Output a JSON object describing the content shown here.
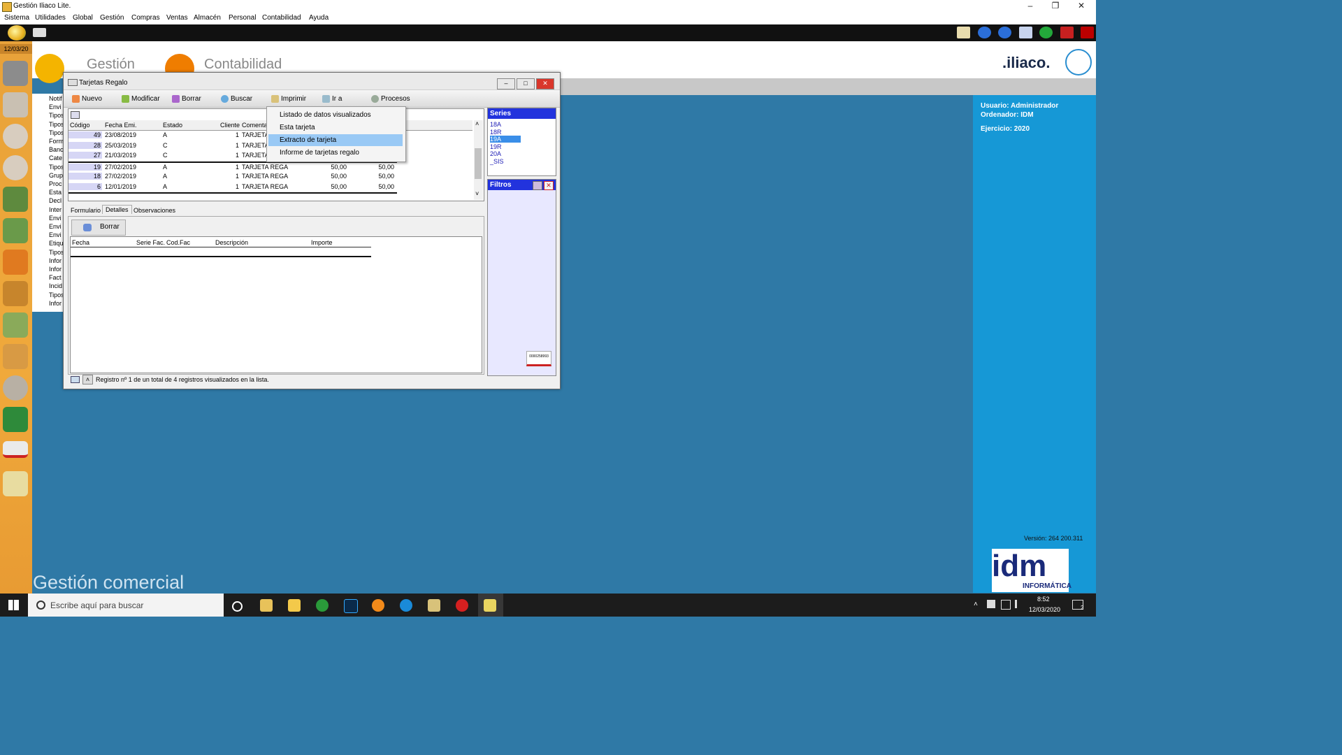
{
  "window_title": "Gestión Iliaco Lite.",
  "menu": [
    "Sistema",
    "Utilidades",
    "Global",
    "Gestión",
    "Compras",
    "Ventas",
    "Almacén",
    "Personal",
    "Contabilidad",
    "Ayuda"
  ],
  "date_badge": "12/03/20",
  "header": {
    "logo1": "Gestión",
    "logo2": "Contabilidad",
    "brand": ".iliaco."
  },
  "user_panel": {
    "usuario": "Usuario: Administrador",
    "ordenador": "Ordenador: IDM",
    "ejercicio": "Ejercicio: 2020",
    "version": "Versión: 264 200.311",
    "idm": "idm",
    "informatica": "INFORMÁTICA"
  },
  "footer_title": "Gestión comercial",
  "left_names": [
    "Notif",
    "Envi",
    "Tipos",
    "Tipos",
    "Tipos",
    "Form",
    "Banc",
    "Cate",
    "Tipos",
    "Grup",
    "Proc",
    "Esta",
    "Decl",
    "Inter",
    "Envi",
    "Envi",
    "Envi",
    "Etiqu",
    "Tipos",
    "Infor",
    "Infor",
    "Fact",
    "Incid",
    "Tipos",
    "Infor"
  ],
  "tarjetas": {
    "title": "Tarjetas Regalo",
    "toolbar": [
      "Nuevo",
      "Modificar",
      "Borrar",
      "Buscar",
      "Imprimir",
      "Ir a",
      "Procesos"
    ],
    "columns": [
      "Código",
      "Fecha Emi.",
      "Estado",
      "Cliente",
      "Comenta"
    ],
    "rows": [
      {
        "codigo": "49",
        "fecha": "23/08/2019",
        "estado": "A",
        "cliente": "1",
        "comentario": "TARJETA",
        "v1": "",
        "v2": ""
      },
      {
        "codigo": "28",
        "fecha": "25/03/2019",
        "estado": "C",
        "cliente": "1",
        "comentario": "TARJETA",
        "v1": "",
        "v2": ""
      },
      {
        "codigo": "27",
        "fecha": "21/03/2019",
        "estado": "C",
        "cliente": "1",
        "comentario": "TARJETA",
        "v1": "",
        "v2": ""
      },
      {
        "codigo": "19",
        "fecha": "27/02/2019",
        "estado": "A",
        "cliente": "1",
        "comentario": "TARJETA REGA",
        "v1": "50,00",
        "v2": "50,00"
      },
      {
        "codigo": "18",
        "fecha": "27/02/2019",
        "estado": "A",
        "cliente": "1",
        "comentario": "TARJETA REGA",
        "v1": "50,00",
        "v2": "50,00"
      },
      {
        "codigo": "6",
        "fecha": "12/01/2019",
        "estado": "A",
        "cliente": "1",
        "comentario": "TARJETA REGA",
        "v1": "50,00",
        "v2": "50,00"
      }
    ],
    "popup": [
      "Listado de datos visualizados",
      "Esta tarjeta",
      "Extracto de tarjeta",
      "Informe de tarjetas regalo"
    ],
    "series": {
      "title": "Series",
      "items": [
        "18A",
        "18R",
        "19A",
        "19R",
        "20A",
        "_SIS"
      ],
      "selected": "19A"
    },
    "filtros": {
      "title": "Filtros"
    },
    "tabs": [
      "Formulario",
      "Detalles",
      "Observaciones"
    ],
    "detail_button": "Borrar",
    "detail_columns": [
      "Fecha",
      "Serie Fac.",
      "Cod.Fac",
      "Descripción",
      "Importe"
    ],
    "status": "Registro nº 1 de un total de 4 registros visualizados en la lista.",
    "card_label": "0000258993"
  },
  "taskbar": {
    "search_placeholder": "Escribe aquí para buscar",
    "time": "8:52",
    "date": "12/03/2020",
    "notif_count": "2"
  }
}
